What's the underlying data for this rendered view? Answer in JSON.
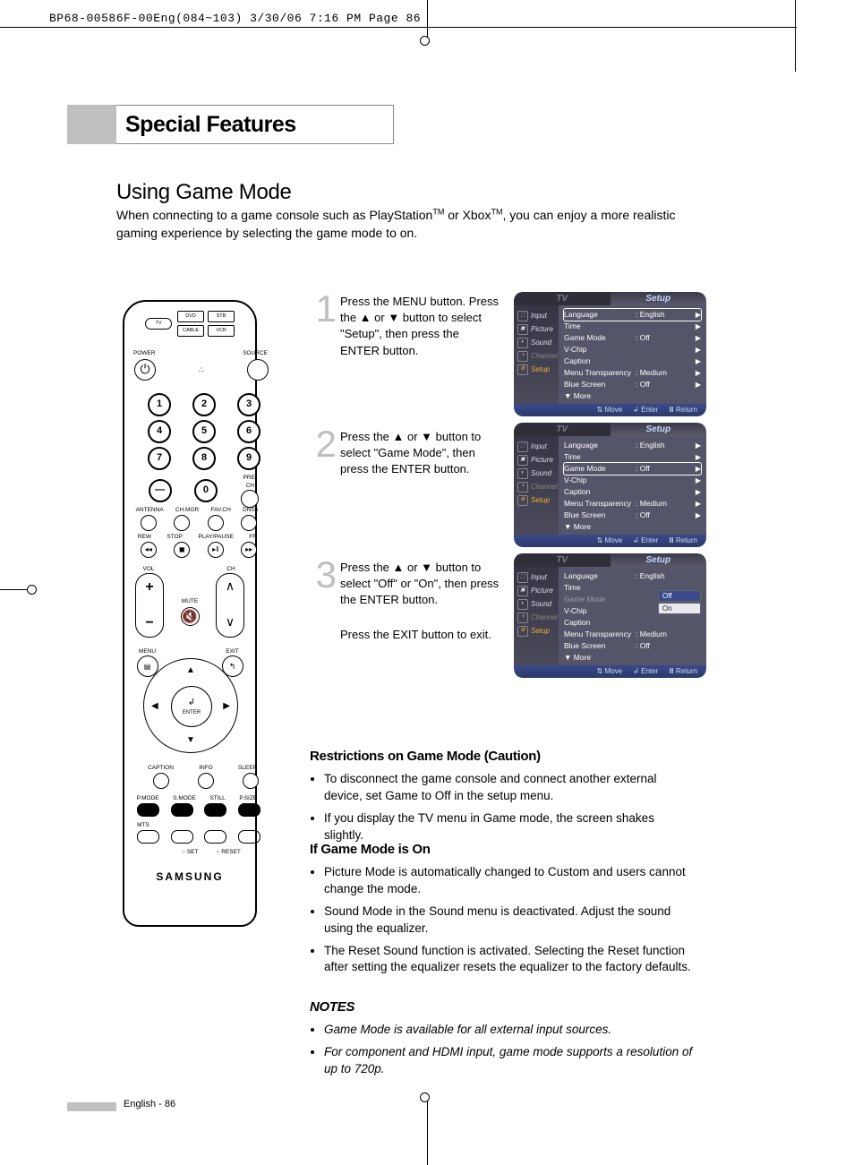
{
  "slug": "BP68-00586F-00Eng(084~103)  3/30/06  7:16 PM  Page 86",
  "chapter": "Special Features",
  "section": "Using Game Mode",
  "intro_a": "When connecting to a game console such as PlayStation",
  "intro_b": " or Xbox",
  "intro_c": ", you can enjoy a more realistic gaming experience by selecting the game mode to on.",
  "tm": "TM",
  "steps": [
    {
      "n": "1",
      "text": "Press the MENU button. Press the ▲ or ▼ button to select \"Setup\", then press the ENTER button."
    },
    {
      "n": "2",
      "text": "Press the ▲ or ▼ button to select \"Game Mode\", then press the ENTER button."
    },
    {
      "n": "3",
      "text": "Press the ▲ or ▼ button to select \"Off\" or \"On\", then press the ENTER button."
    },
    {
      "n": "",
      "text": "Press the EXIT button to exit."
    }
  ],
  "osd": {
    "tabs": [
      "TV",
      "Setup"
    ],
    "side": [
      "Input",
      "Picture",
      "Sound",
      "Channel",
      "Setup"
    ],
    "rows": {
      "language": "Language",
      "language_v": ": English",
      "time": "Time",
      "game": "Game Mode",
      "game_v": ": Off",
      "vchip": "V-Chip",
      "caption": "Caption",
      "menu_t": "Menu Transparency",
      "menu_t_v": ": Medium",
      "blue": "Blue Screen",
      "blue_v": ": Off",
      "more": "▼ More"
    },
    "opts": {
      "off": "Off",
      "on": "On"
    },
    "foot": {
      "move": "Move",
      "enter": "Enter",
      "return": "Return"
    }
  },
  "restrictions": {
    "title": "Restrictions on Game Mode (Caution)",
    "items": [
      "To disconnect the game console and connect another external device, set Game to Off in the setup menu.",
      "If you display the TV menu in Game mode, the screen shakes slightly."
    ]
  },
  "ifon": {
    "title": "If Game Mode is On",
    "items": [
      "Picture Mode is automatically changed to Custom and users cannot change the mode.",
      "Sound Mode in the Sound menu is deactivated. Adjust the sound using the equalizer.",
      "The Reset Sound function is activated. Selecting the Reset function after setting the equalizer resets the equalizer to the factory defaults."
    ]
  },
  "notes": {
    "title": "NOTES",
    "items": [
      "Game Mode is available for all external input sources.",
      "For component and HDMI input, game mode supports a resolution of up to 720p."
    ]
  },
  "remote": {
    "dev": [
      "TV",
      "DVD",
      "STB",
      "CABLE",
      "VCR"
    ],
    "power": "POWER",
    "source": "SOURCE",
    "nums": [
      "1",
      "2",
      "3",
      "4",
      "5",
      "6",
      "7",
      "8",
      "9",
      "0"
    ],
    "dash": "—",
    "prech": "PRE-CH",
    "row_a": [
      "ANTENNA",
      "CH.MGR",
      "FAV.CH",
      "DNSe"
    ],
    "transport": [
      "REW",
      "STOP",
      "PLAY/PAUSE",
      "FF"
    ],
    "vol": "VOL",
    "ch": "CH",
    "mute": "MUTE",
    "menu": "MENU",
    "exit": "EXIT",
    "enter": "ENTER",
    "row_b": [
      "CAPTION",
      "INFO",
      "SLEEP"
    ],
    "row_c": [
      "P.MODE",
      "S.MODE",
      "STILL",
      "P.SIZE"
    ],
    "mts": "MTS",
    "set": "SET",
    "reset": "RESET",
    "brand": "SAMSUNG"
  },
  "footer": "English - 86"
}
